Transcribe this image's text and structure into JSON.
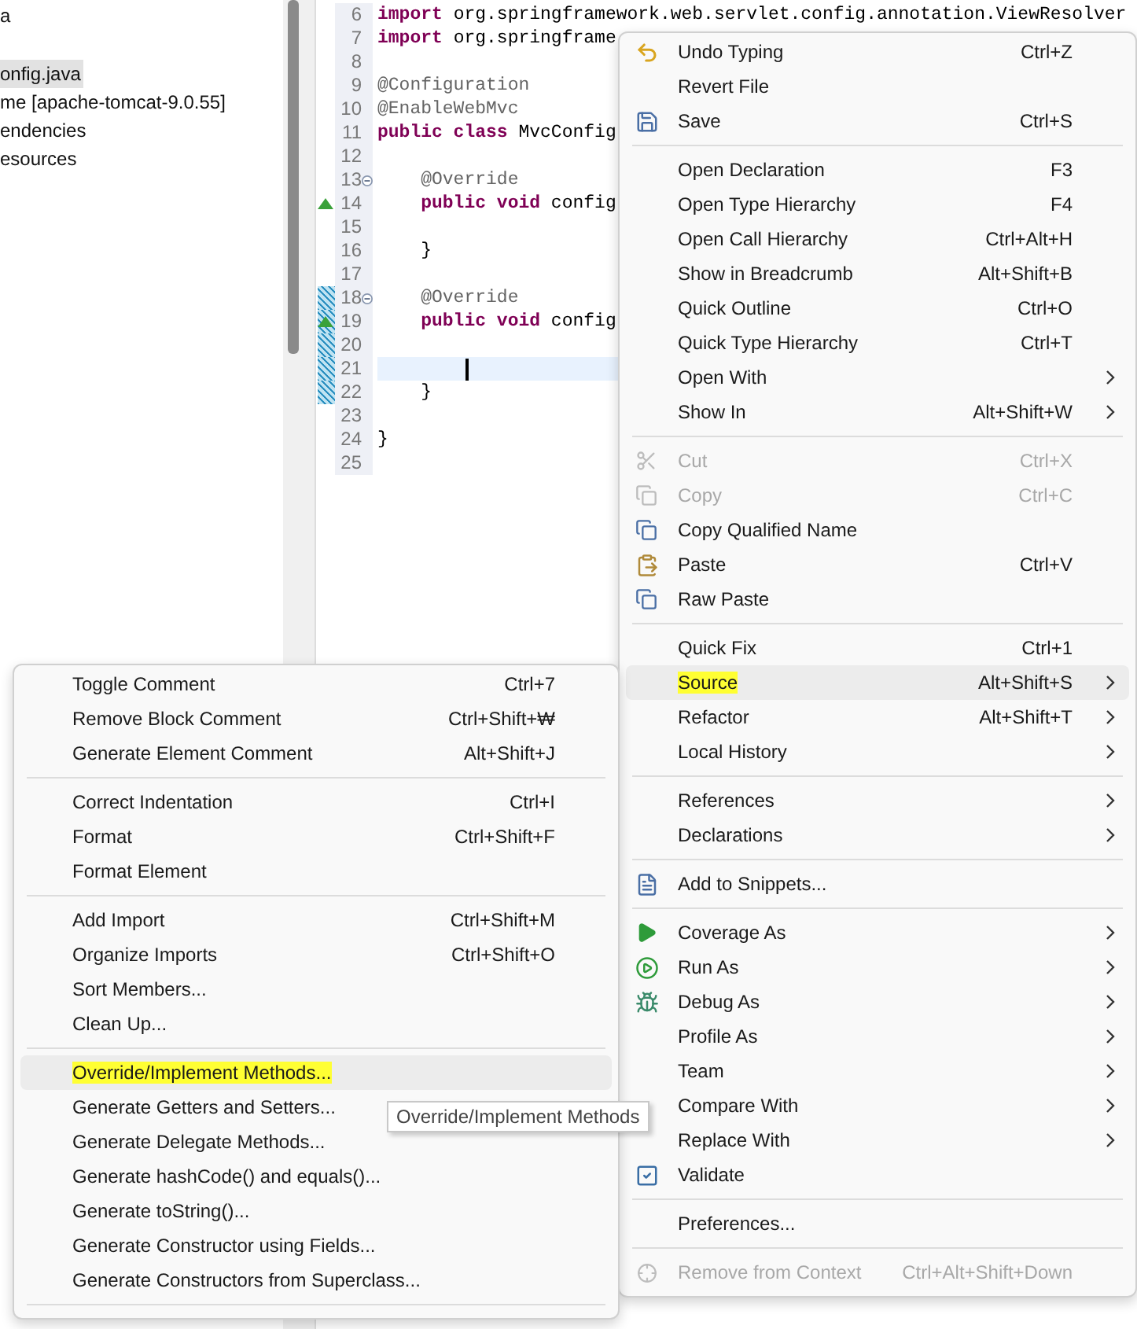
{
  "explorer": {
    "items": [
      {
        "label": "a",
        "selected": false
      },
      {
        "label": "onfig.java",
        "selected": true
      },
      {
        "label": "me [apache-tomcat-9.0.55]",
        "selected": false
      },
      {
        "label": "endencies",
        "selected": false
      },
      {
        "label": "esources",
        "selected": false
      }
    ]
  },
  "editor": {
    "lines": [
      {
        "number": "6",
        "tokens": [
          {
            "kind": "keyword",
            "text": "import"
          },
          {
            "kind": "plain",
            "text": " org.springframework.web.servlet.config.annotation.ViewResolver"
          }
        ]
      },
      {
        "number": "7",
        "tokens": [
          {
            "kind": "keyword",
            "text": "import"
          },
          {
            "kind": "plain",
            "text": " org.springframe"
          }
        ]
      },
      {
        "number": "8"
      },
      {
        "number": "9",
        "tokens": [
          {
            "kind": "annotation",
            "text": "@Configuration"
          }
        ]
      },
      {
        "number": "10",
        "tokens": [
          {
            "kind": "annotation",
            "text": "@EnableWebMvc"
          }
        ]
      },
      {
        "number": "11",
        "tokens": [
          {
            "kind": "keyword",
            "text": "public class"
          },
          {
            "kind": "plain",
            "text": " MvcConfig"
          }
        ]
      },
      {
        "number": "12"
      },
      {
        "number": "13",
        "fold": true,
        "tokens": [
          {
            "kind": "annotation",
            "text": "    @Override"
          }
        ]
      },
      {
        "number": "14",
        "override_marker": true,
        "tokens": [
          {
            "kind": "keyword",
            "text": "    public void"
          },
          {
            "kind": "plain",
            "text": " config"
          }
        ]
      },
      {
        "number": "15"
      },
      {
        "number": "16",
        "tokens": [
          {
            "kind": "plain",
            "text": "    }"
          }
        ]
      },
      {
        "number": "17"
      },
      {
        "number": "18",
        "changed": true,
        "fold": true,
        "tokens": [
          {
            "kind": "annotation",
            "text": "    @Override"
          }
        ]
      },
      {
        "number": "19",
        "changed": true,
        "override_marker": true,
        "tokens": [
          {
            "kind": "keyword",
            "text": "    public void"
          },
          {
            "kind": "plain",
            "text": " config"
          }
        ]
      },
      {
        "number": "20",
        "changed": true
      },
      {
        "number": "21",
        "current": true,
        "changed": true
      },
      {
        "number": "22",
        "changed": true,
        "tokens": [
          {
            "kind": "plain",
            "text": "    }"
          }
        ]
      },
      {
        "number": "23"
      },
      {
        "number": "24",
        "tokens": [
          {
            "kind": "plain",
            "text": "}"
          }
        ]
      },
      {
        "number": "25"
      }
    ]
  },
  "context_menu": {
    "items": [
      {
        "kind": "item",
        "label": "Undo Typing",
        "shortcut": "Ctrl+Z",
        "submenu": false,
        "disabled": false,
        "selected": false,
        "highlighted": false
      },
      {
        "kind": "item",
        "label": "Revert File",
        "submenu": false,
        "disabled": false,
        "selected": false,
        "highlighted": false
      },
      {
        "kind": "item",
        "label": "Save",
        "shortcut": "Ctrl+S",
        "submenu": false,
        "disabled": false,
        "selected": false,
        "highlighted": false
      },
      {
        "kind": "separator"
      },
      {
        "kind": "item",
        "label": "Open Declaration",
        "shortcut": "F3",
        "submenu": false,
        "disabled": false,
        "selected": false,
        "highlighted": false
      },
      {
        "kind": "item",
        "label": "Open Type Hierarchy",
        "shortcut": "F4",
        "submenu": false,
        "disabled": false,
        "selected": false,
        "highlighted": false
      },
      {
        "kind": "item",
        "label": "Open Call Hierarchy",
        "shortcut": "Ctrl+Alt+H",
        "submenu": false,
        "disabled": false,
        "selected": false,
        "highlighted": false
      },
      {
        "kind": "item",
        "label": "Show in Breadcrumb",
        "shortcut": "Alt+Shift+B",
        "submenu": false,
        "disabled": false,
        "selected": false,
        "highlighted": false
      },
      {
        "kind": "item",
        "label": "Quick Outline",
        "shortcut": "Ctrl+O",
        "submenu": false,
        "disabled": false,
        "selected": false,
        "highlighted": false
      },
      {
        "kind": "item",
        "label": "Quick Type Hierarchy",
        "shortcut": "Ctrl+T",
        "submenu": false,
        "disabled": false,
        "selected": false,
        "highlighted": false
      },
      {
        "kind": "item",
        "label": "Open With",
        "submenu": true,
        "disabled": false,
        "selected": false,
        "highlighted": false
      },
      {
        "kind": "item",
        "label": "Show In",
        "shortcut": "Alt+Shift+W",
        "submenu": true,
        "disabled": false,
        "selected": false,
        "highlighted": false
      },
      {
        "kind": "separator"
      },
      {
        "kind": "item",
        "label": "Cut",
        "shortcut": "Ctrl+X",
        "submenu": false,
        "disabled": true,
        "selected": false,
        "highlighted": false
      },
      {
        "kind": "item",
        "label": "Copy",
        "shortcut": "Ctrl+C",
        "submenu": false,
        "disabled": true,
        "selected": false,
        "highlighted": false
      },
      {
        "kind": "item",
        "label": "Copy Qualified Name",
        "submenu": false,
        "disabled": false,
        "selected": false,
        "highlighted": false
      },
      {
        "kind": "item",
        "label": "Paste",
        "shortcut": "Ctrl+V",
        "submenu": false,
        "disabled": false,
        "selected": false,
        "highlighted": false
      },
      {
        "kind": "item",
        "label": "Raw Paste",
        "submenu": false,
        "disabled": false,
        "selected": false,
        "highlighted": false
      },
      {
        "kind": "separator"
      },
      {
        "kind": "item",
        "label": "Quick Fix",
        "shortcut": "Ctrl+1",
        "submenu": false,
        "disabled": false,
        "selected": false,
        "highlighted": false
      },
      {
        "kind": "item",
        "label": "Source",
        "shortcut": "Alt+Shift+S",
        "submenu": true,
        "disabled": false,
        "selected": true,
        "highlighted": true
      },
      {
        "kind": "item",
        "label": "Refactor",
        "shortcut": "Alt+Shift+T",
        "submenu": true,
        "disabled": false,
        "selected": false,
        "highlighted": false
      },
      {
        "kind": "item",
        "label": "Local History",
        "submenu": true,
        "disabled": false,
        "selected": false,
        "highlighted": false
      },
      {
        "kind": "separator"
      },
      {
        "kind": "item",
        "label": "References",
        "submenu": true,
        "disabled": false,
        "selected": false,
        "highlighted": false
      },
      {
        "kind": "item",
        "label": "Declarations",
        "submenu": true,
        "disabled": false,
        "selected": false,
        "highlighted": false
      },
      {
        "kind": "separator"
      },
      {
        "kind": "item",
        "label": "Add to Snippets...",
        "submenu": false,
        "disabled": false,
        "selected": false,
        "highlighted": false
      },
      {
        "kind": "separator"
      },
      {
        "kind": "item",
        "label": "Coverage As",
        "submenu": true,
        "disabled": false,
        "selected": false,
        "highlighted": false
      },
      {
        "kind": "item",
        "label": "Run As",
        "submenu": true,
        "disabled": false,
        "selected": false,
        "highlighted": false
      },
      {
        "kind": "item",
        "label": "Debug As",
        "submenu": true,
        "disabled": false,
        "selected": false,
        "highlighted": false
      },
      {
        "kind": "item",
        "label": "Profile As",
        "submenu": true,
        "disabled": false,
        "selected": false,
        "highlighted": false
      },
      {
        "kind": "item",
        "label": "Team",
        "submenu": true,
        "disabled": false,
        "selected": false,
        "highlighted": false
      },
      {
        "kind": "item",
        "label": "Compare With",
        "submenu": true,
        "disabled": false,
        "selected": false,
        "highlighted": false
      },
      {
        "kind": "item",
        "label": "Replace With",
        "submenu": true,
        "disabled": false,
        "selected": false,
        "highlighted": false
      },
      {
        "kind": "item",
        "label": "Validate",
        "submenu": false,
        "disabled": false,
        "selected": false,
        "highlighted": false
      },
      {
        "kind": "separator"
      },
      {
        "kind": "item",
        "label": "Preferences...",
        "submenu": false,
        "disabled": false,
        "selected": false,
        "highlighted": false
      },
      {
        "kind": "separator"
      },
      {
        "kind": "item",
        "label": "Remove from Context",
        "shortcut": "Ctrl+Alt+Shift+Down",
        "submenu": false,
        "disabled": true,
        "selected": false,
        "highlighted": false
      }
    ]
  },
  "source_submenu": {
    "items": [
      {
        "kind": "item",
        "label": "Toggle Comment",
        "shortcut": "Ctrl+7",
        "selected": false,
        "highlighted": false
      },
      {
        "kind": "item",
        "label": "Remove Block Comment",
        "shortcut": "Ctrl+Shift+₩",
        "selected": false,
        "highlighted": false
      },
      {
        "kind": "item",
        "label": "Generate Element Comment",
        "shortcut": "Alt+Shift+J",
        "selected": false,
        "highlighted": false
      },
      {
        "kind": "separator"
      },
      {
        "kind": "item",
        "label": "Correct Indentation",
        "shortcut": "Ctrl+I",
        "selected": false,
        "highlighted": false
      },
      {
        "kind": "item",
        "label": "Format",
        "shortcut": "Ctrl+Shift+F",
        "selected": false,
        "highlighted": false
      },
      {
        "kind": "item",
        "label": "Format Element",
        "selected": false,
        "highlighted": false
      },
      {
        "kind": "separator"
      },
      {
        "kind": "item",
        "label": "Add Import",
        "shortcut": "Ctrl+Shift+M",
        "selected": false,
        "highlighted": false
      },
      {
        "kind": "item",
        "label": "Organize Imports",
        "shortcut": "Ctrl+Shift+O",
        "selected": false,
        "highlighted": false
      },
      {
        "kind": "item",
        "label": "Sort Members...",
        "selected": false,
        "highlighted": false
      },
      {
        "kind": "item",
        "label": "Clean Up...",
        "selected": false,
        "highlighted": false
      },
      {
        "kind": "separator"
      },
      {
        "kind": "item",
        "label": "Override/Implement Methods...",
        "selected": true,
        "highlighted": true
      },
      {
        "kind": "item",
        "label": "Generate Getters and Setters...",
        "selected": false,
        "highlighted": false
      },
      {
        "kind": "item",
        "label": "Generate Delegate Methods...",
        "selected": false,
        "highlighted": false
      },
      {
        "kind": "item",
        "label": "Generate hashCode() and equals()...",
        "selected": false,
        "highlighted": false
      },
      {
        "kind": "item",
        "label": "Generate toString()...",
        "selected": false,
        "highlighted": false
      },
      {
        "kind": "item",
        "label": "Generate Constructor using Fields...",
        "selected": false,
        "highlighted": false
      },
      {
        "kind": "item",
        "label": "Generate Constructors from Superclass...",
        "selected": false,
        "highlighted": false
      },
      {
        "kind": "separator"
      }
    ]
  },
  "tooltip": {
    "text": "Override/Implement Methods"
  }
}
